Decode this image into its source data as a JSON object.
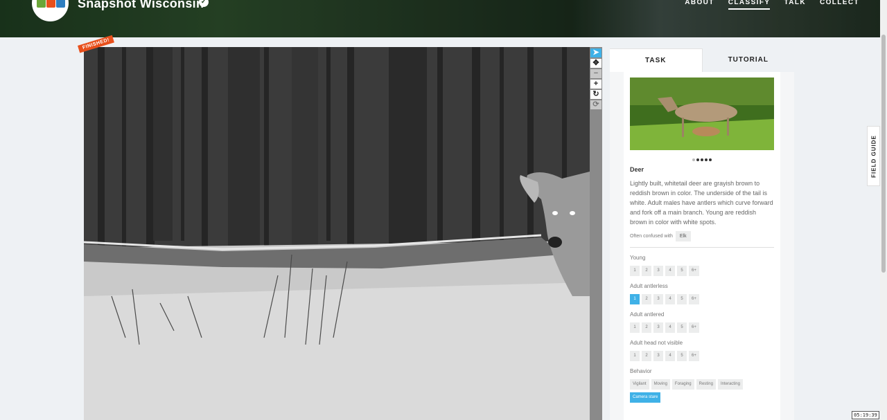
{
  "header": {
    "project_title": "Snapshot Wisconsin",
    "nav": [
      {
        "label": "ABOUT"
      },
      {
        "label": "CLASSIFY",
        "active": true
      },
      {
        "label": "TALK"
      },
      {
        "label": "COLLECT"
      }
    ],
    "verified_icon": "check-badge-icon"
  },
  "subject": {
    "badge": "FINISHED!"
  },
  "tools": [
    {
      "name": "pointer-tool",
      "glyph": "➤",
      "active": true
    },
    {
      "name": "pan-tool",
      "glyph": "✥"
    },
    {
      "name": "zoom-out-tool",
      "glyph": "−",
      "disabled": true
    },
    {
      "name": "zoom-in-tool",
      "glyph": "+"
    },
    {
      "name": "rotate-tool",
      "glyph": "↻"
    },
    {
      "name": "reset-tool",
      "glyph": "⟳",
      "disabled": true
    }
  ],
  "panel": {
    "tabs": [
      {
        "label": "TASK",
        "active": true
      },
      {
        "label": "TUTORIAL"
      }
    ],
    "species": {
      "name": "Deer",
      "description": "Lightly built, whitetail deer are grayish brown to reddish brown in color. The underside of the tail is white. Adult males have antlers which curve forward and fork off a main branch. Young are reddish brown in color with white spots.",
      "confused_label": "Often confused with",
      "confused_with": [
        "Elk"
      ],
      "dots_total": 5,
      "dots_active": 4
    },
    "questions": [
      {
        "label": "Young",
        "options": [
          "1",
          "2",
          "3",
          "4",
          "5",
          "6+"
        ],
        "selected": null
      },
      {
        "label": "Adult antlerless",
        "options": [
          "1",
          "2",
          "3",
          "4",
          "5",
          "6+"
        ],
        "selected": 0
      },
      {
        "label": "Adult antlered",
        "options": [
          "1",
          "2",
          "3",
          "4",
          "5",
          "6+"
        ],
        "selected": null
      },
      {
        "label": "Adult head not visible",
        "options": [
          "1",
          "2",
          "3",
          "4",
          "5",
          "6+"
        ],
        "selected": null
      }
    ],
    "behavior": {
      "label": "Behavior",
      "options": [
        "Vigilant",
        "Moving",
        "Foraging",
        "Resting",
        "Interacting",
        "Camera stare"
      ],
      "selected": [
        5
      ]
    }
  },
  "field_guide": {
    "label": "FIELD GUIDE"
  },
  "clock": {
    "time": "05:19:39"
  },
  "colors": {
    "accent": "#3fb1e7",
    "badge": "#e8501c"
  }
}
